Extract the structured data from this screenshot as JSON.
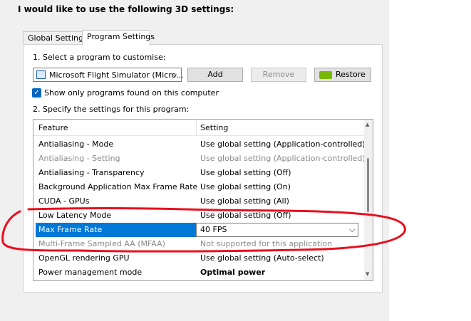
{
  "heading": "I would like to use the following 3D settings:",
  "tabs": [
    {
      "label": "Global Settings",
      "active": false
    },
    {
      "label": "Program Settings",
      "active": true
    }
  ],
  "step1": {
    "label": "1. Select a program to customise:",
    "program": "Microsoft Flight Simulator (Micro...",
    "add_label": "Add",
    "remove_label": "Remove",
    "restore_label": "Restore"
  },
  "show_only": {
    "label": "Show only programs found on this computer",
    "checked": true
  },
  "step2": {
    "label": "2. Specify the settings for this program:"
  },
  "table": {
    "columns": [
      "Feature",
      "Setting"
    ],
    "rows": [
      {
        "feature": "Antialiasing - Mode",
        "setting": "Use global setting (Application-controlled)",
        "state": "normal"
      },
      {
        "feature": "Antialiasing - Setting",
        "setting": "Use global setting (Application-controlled)",
        "state": "disabled"
      },
      {
        "feature": "Antialiasing - Transparency",
        "setting": "Use global setting (Off)",
        "state": "normal"
      },
      {
        "feature": "Background Application Max Frame Rate",
        "setting": "Use global setting (On)",
        "state": "normal"
      },
      {
        "feature": "CUDA - GPUs",
        "setting": "Use global setting (All)",
        "state": "normal"
      },
      {
        "feature": "Low Latency Mode",
        "setting": "Use global setting (Off)",
        "state": "normal"
      },
      {
        "feature": "Max Frame Rate",
        "setting": "40 FPS",
        "state": "selected"
      },
      {
        "feature": "Multi-Frame Sampled AA (MFAA)",
        "setting": "Not supported for this application",
        "state": "disabled"
      },
      {
        "feature": "OpenGL rendering GPU",
        "setting": "Use global setting (Auto-select)",
        "state": "normal"
      },
      {
        "feature": "Power management mode",
        "setting": "Optimal power",
        "state": "bold"
      }
    ]
  },
  "colors": {
    "selection": "#0078d7",
    "annotation": "#e8101e",
    "nvidia": "#76b900"
  }
}
